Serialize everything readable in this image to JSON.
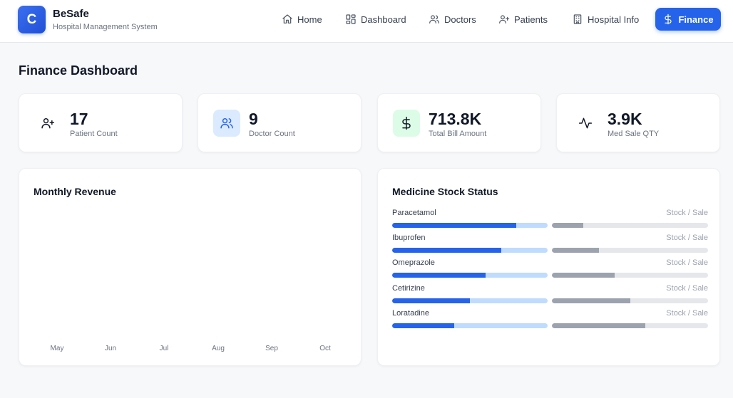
{
  "brand": {
    "logo_letter": "C",
    "name": "BeSafe",
    "subtitle": "Hospital Management System"
  },
  "nav": [
    {
      "label": "Home",
      "icon": "home-icon"
    },
    {
      "label": "Dashboard",
      "icon": "dashboard-icon"
    },
    {
      "label": "Doctors",
      "icon": "users-icon"
    },
    {
      "label": "Patients",
      "icon": "user-plus-icon"
    },
    {
      "label": "Hospital Info",
      "icon": "building-icon"
    },
    {
      "label": "Finance",
      "icon": "dollar-icon",
      "active": true
    }
  ],
  "page": {
    "title": "Finance Dashboard"
  },
  "stats": [
    {
      "value": "17",
      "label": "Patient Count",
      "icon": "user-plus-icon"
    },
    {
      "value": "9",
      "label": "Doctor Count",
      "icon": "users-icon"
    },
    {
      "value": "713.8K",
      "label": "Total Bill Amount",
      "icon": "dollar-icon"
    },
    {
      "value": "3.9K",
      "label": "Med Sale QTY",
      "icon": "activity-icon"
    }
  ],
  "revenue": {
    "title": "Monthly Revenue",
    "months": [
      "May",
      "Jun",
      "Jul",
      "Aug",
      "Sep",
      "Oct"
    ]
  },
  "stock": {
    "title": "Medicine Stock Status",
    "items": [
      {
        "name": "Paracetamol",
        "meta": "Stock / Sale",
        "stock": 0.8,
        "sale": 0.2
      },
      {
        "name": "Ibuprofen",
        "meta": "Stock / Sale",
        "stock": 0.7,
        "sale": 0.3
      },
      {
        "name": "Omeprazole",
        "meta": "Stock / Sale",
        "stock": 0.6,
        "sale": 0.4
      },
      {
        "name": "Cetirizine",
        "meta": "Stock / Sale",
        "stock": 0.5,
        "sale": 0.5
      },
      {
        "name": "Loratadine",
        "meta": "Stock / Sale",
        "stock": 0.4,
        "sale": 0.6
      }
    ]
  },
  "colors": {
    "primary": "#2563eb",
    "stock_track": "#bfdbfe",
    "sale_fill": "#9ca3af",
    "sale_track": "#e5e7eb"
  }
}
